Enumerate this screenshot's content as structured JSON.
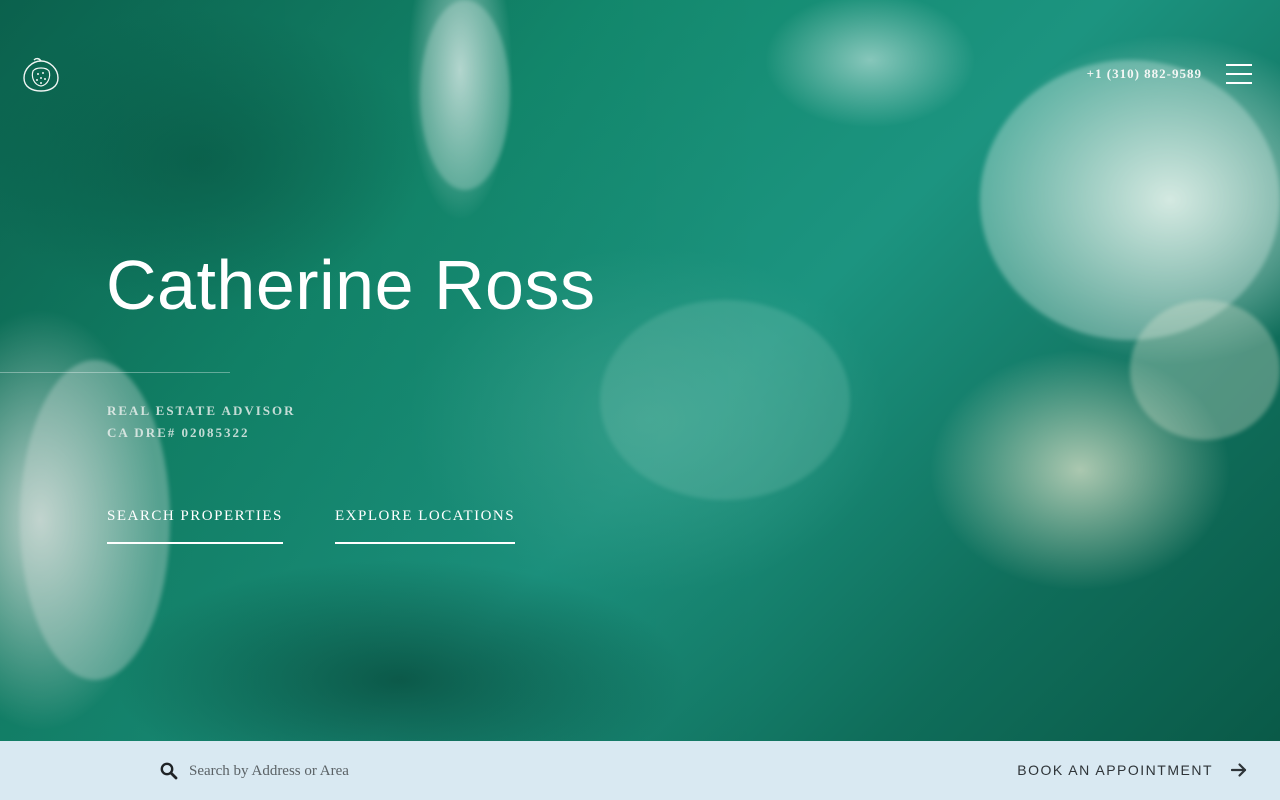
{
  "header": {
    "logo": "fig-leaf-logo",
    "phone": "+1 (310) 882-9589",
    "menu_icon": "hamburger-menu-icon"
  },
  "hero": {
    "name": "Catherine Ross",
    "role_line1": "REAL ESTATE ADVISOR",
    "role_line2": "CA DRE# 02085322",
    "cta_search": "SEARCH PROPERTIES",
    "cta_explore": "EXPLORE LOCATIONS"
  },
  "bottom_bar": {
    "search_icon": "search-icon",
    "search_placeholder": "Search by Address or Area",
    "book_label": "BOOK AN APPOINTMENT",
    "arrow_icon": "arrow-right-icon",
    "background": "#d9e9f2"
  }
}
